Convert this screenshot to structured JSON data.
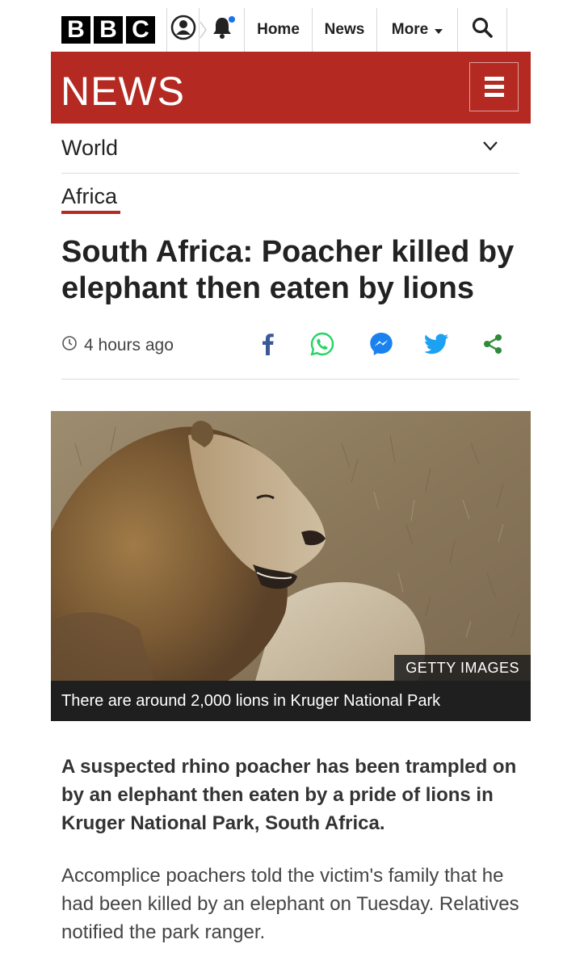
{
  "header": {
    "logo_letters": [
      "B",
      "B",
      "C"
    ],
    "nav": {
      "home": "Home",
      "news": "News",
      "more": "More"
    },
    "icons": {
      "account": "account-icon",
      "notifications": "bell-icon",
      "search": "search-icon"
    },
    "notification_dot_color": "#1a73e8"
  },
  "banner": {
    "title": "NEWS",
    "color": "#b42a22",
    "menu_icon": "hamburger-menu-icon"
  },
  "section": {
    "label": "World",
    "dropdown_icon": "chevron-down-icon"
  },
  "category": {
    "label": "Africa"
  },
  "article": {
    "headline": "South Africa: Poacher killed by elephant then eaten by lions",
    "timestamp": "4 hours ago",
    "share_icons": [
      "facebook-icon",
      "whatsapp-icon",
      "messenger-icon",
      "twitter-icon",
      "share-icon"
    ],
    "image": {
      "credit": "GETTY IMAGES",
      "caption": "There are around 2,000 lions in Kruger National Park"
    },
    "lede": "A suspected rhino poacher has been trampled on by an elephant then eaten by a pride of lions in Kruger National Park, South Africa.",
    "body": "Accomplice poachers told the victim's family that he had been killed by an elephant on Tuesday. Relatives notified the park ranger."
  }
}
